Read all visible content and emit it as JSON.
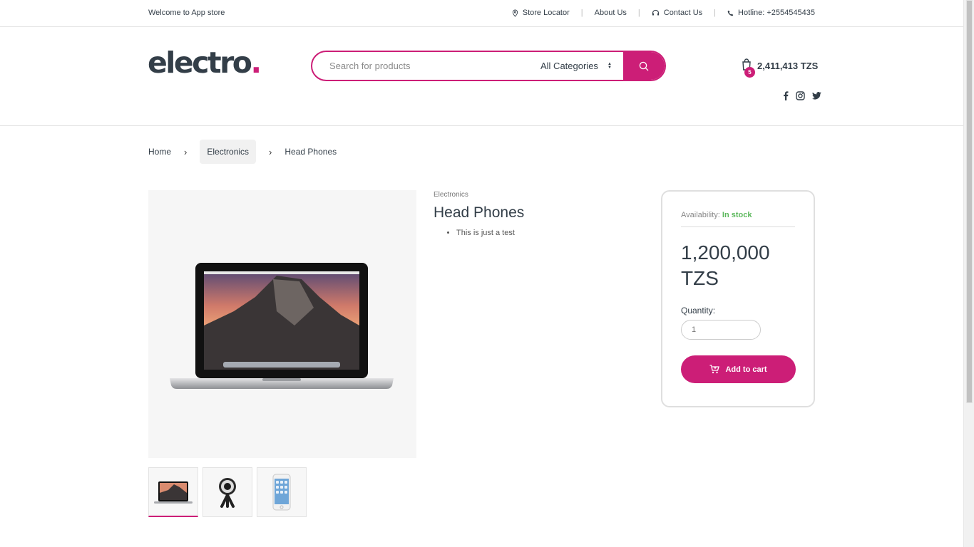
{
  "topbar": {
    "welcome": "Welcome to App store",
    "links": [
      {
        "label": "Store Locator",
        "icon": "map-pin-icon"
      },
      {
        "label": "About Us"
      },
      {
        "label": "Contact Us",
        "icon": "headset-icon"
      },
      {
        "label": "Hotline: +2554545435",
        "icon": "phone-icon"
      }
    ]
  },
  "header": {
    "logo_text": "electro",
    "logo_dot": ".",
    "search_placeholder": "Search for products",
    "category_selected": "All Categories",
    "cart_count": "5",
    "cart_total": "2,411,413 TZS",
    "social": [
      "facebook-icon",
      "instagram-icon",
      "twitter-icon"
    ]
  },
  "breadcrumb": [
    "Home",
    "Electronics",
    "Head Phones"
  ],
  "product": {
    "category": "Electronics",
    "title": "Head Phones",
    "bullets": [
      "This is just a test"
    ],
    "availability_label": "Availability:",
    "availability_value": "In stock",
    "price": "1,200,000 TZS",
    "quantity_label": "Quantity:",
    "quantity_value": "1",
    "add_to_cart": "Add to cart"
  },
  "colors": {
    "accent": "#cc1e77",
    "in_stock": "#5cb85c",
    "text": "#333e48"
  }
}
